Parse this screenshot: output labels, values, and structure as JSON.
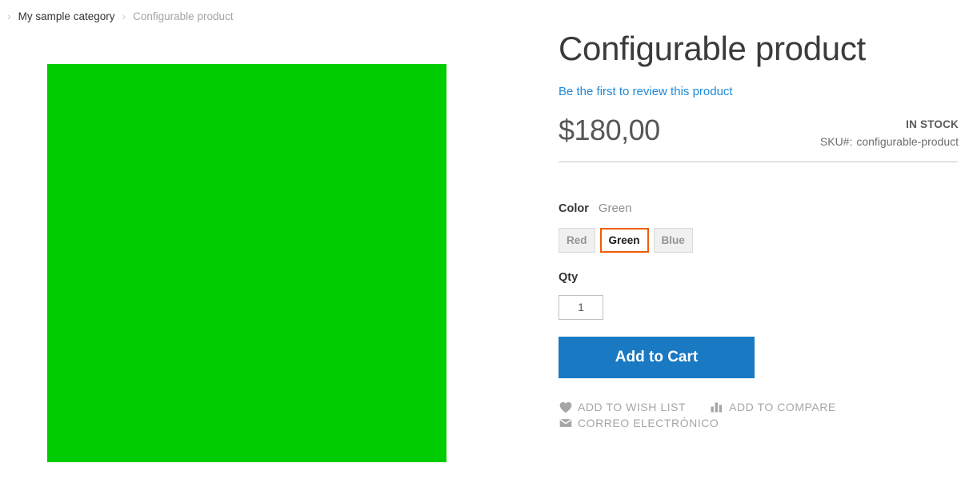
{
  "breadcrumbs": {
    "separator": "›",
    "items": [
      {
        "label": "My sample category",
        "current": false
      },
      {
        "label": "Configurable product",
        "current": true
      }
    ]
  },
  "gallery": {
    "image_alt": "Configurable product main image",
    "image_color": "#00cc00"
  },
  "product": {
    "title": "Configurable product",
    "review_link": "Be the first to review this product",
    "price": "$180,00",
    "stock_status": "IN STOCK",
    "sku_label": "SKU#:",
    "sku_value": "configurable-product"
  },
  "options": {
    "color": {
      "label": "Color",
      "selected_label": "Green",
      "swatches": [
        {
          "label": "Red",
          "selected": false
        },
        {
          "label": "Green",
          "selected": true
        },
        {
          "label": "Blue",
          "selected": false
        }
      ]
    }
  },
  "cart": {
    "qty_label": "Qty",
    "qty_value": "1",
    "add_to_cart_label": "Add to Cart"
  },
  "social_links": {
    "wishlist": "ADD TO WISH LIST",
    "compare": "ADD TO COMPARE",
    "email": "CORREO ELECTRÓNICO"
  },
  "colors": {
    "accent_blue": "#1979c3",
    "link_blue": "#1f8ad6",
    "selected_swatch_border": "#ee5d0a",
    "muted_gray": "#a6a6a6"
  }
}
